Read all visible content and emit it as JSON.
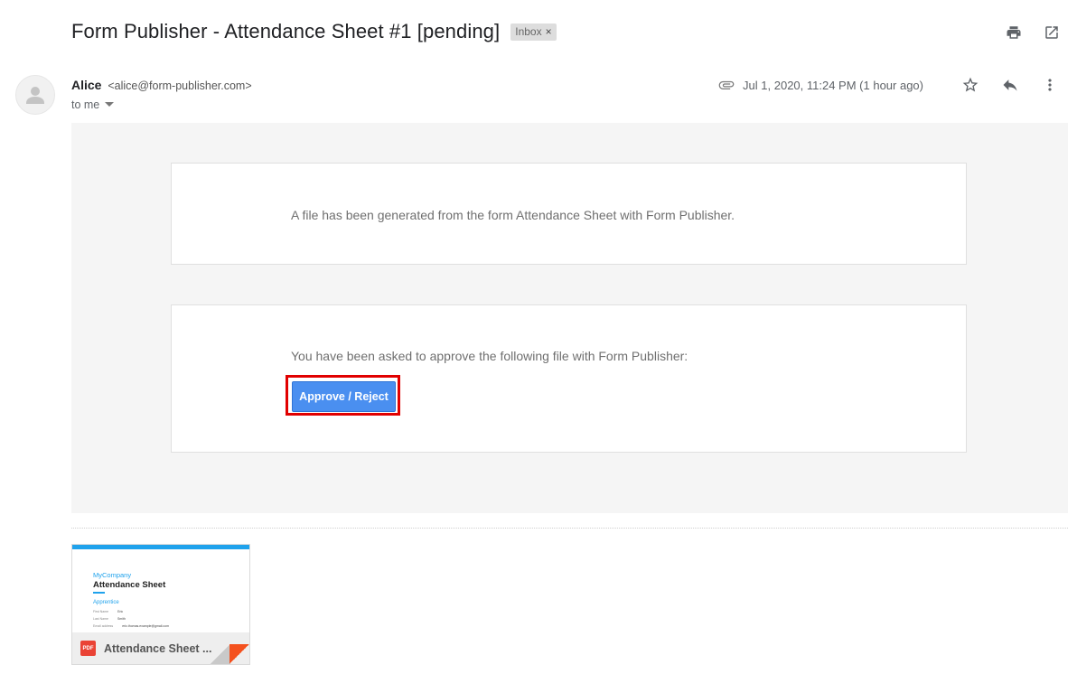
{
  "email": {
    "subject": "Form Publisher - Attendance Sheet #1 [pending]",
    "label": "Inbox",
    "label_remove": "×",
    "sender_name": "Alice",
    "sender_email": "<alice@form-publisher.com>",
    "recipients": "to me",
    "date": "Jul 1, 2020, 11:24 PM (1 hour ago)"
  },
  "body": {
    "notice": "A file has been generated from the form Attendance Sheet with Form Publisher.",
    "approval_prompt": "You have been asked to approve the following file with Form Publisher:",
    "approve_button": "Approve / Reject"
  },
  "attachment": {
    "name": "Attendance Sheet ...",
    "type_badge": "PDF",
    "preview": {
      "company": "MyCompany",
      "title": "Attendance Sheet",
      "section": "Apprentice",
      "rows": [
        {
          "label": "First Name",
          "value": "Eric"
        },
        {
          "label": "Last Name",
          "value": "Smith"
        },
        {
          "label": "Email address",
          "value": "eric.thomas.example@gmail.com"
        }
      ]
    }
  },
  "icons": {
    "print": "print-icon",
    "popout": "open-in-new-window-icon",
    "attachment": "paperclip-icon",
    "star": "star-icon",
    "reply": "reply-icon",
    "more": "more-vertical-icon",
    "avatar": "person-icon",
    "dropdown": "caret-down-icon"
  },
  "colors": {
    "approve_button": "#4a8ff0",
    "highlight": "#e10000",
    "panel_bg": "#f5f5f5",
    "accent": "#1fa2ec",
    "pdf": "#ea4335"
  }
}
